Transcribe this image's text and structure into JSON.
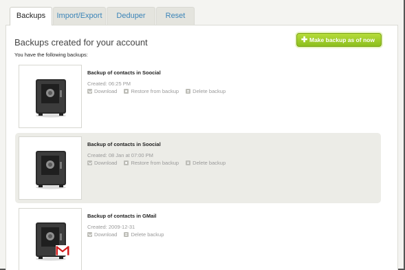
{
  "tabs": [
    {
      "label": "Backups",
      "active": true
    },
    {
      "label": "Import/Export",
      "active": false
    },
    {
      "label": "Deduper",
      "active": false
    },
    {
      "label": "Reset",
      "active": false
    }
  ],
  "header": {
    "title": "Backups created for your account",
    "subtitle": "You have the following backups:",
    "make_backup_label": "Make backup as of now"
  },
  "backups": [
    {
      "name": "Backup of contacts in Soocial",
      "created": "Created: 06:25 PM",
      "actions": [
        "Download",
        "Restore from backup",
        "Delete backup"
      ],
      "icon": "safe-icon",
      "shaded": false
    },
    {
      "name": "Backup of contacts in Soocial",
      "created": "Created: 08 Jan at 07:00 PM",
      "actions": [
        "Download",
        "Restore from backup",
        "Delete backup"
      ],
      "icon": "safe-icon",
      "shaded": true
    },
    {
      "name": "Backup of contacts in GMail",
      "created": "Created: 2009-12-31",
      "actions": [
        "Download",
        "Delete backup"
      ],
      "icon": "safe-icon",
      "badge_icon": "gmail-icon",
      "shaded": false
    }
  ],
  "colors": {
    "accent_green": "#9acb2a",
    "tab_link": "#3a84b8",
    "shaded_row": "#ecece7"
  }
}
